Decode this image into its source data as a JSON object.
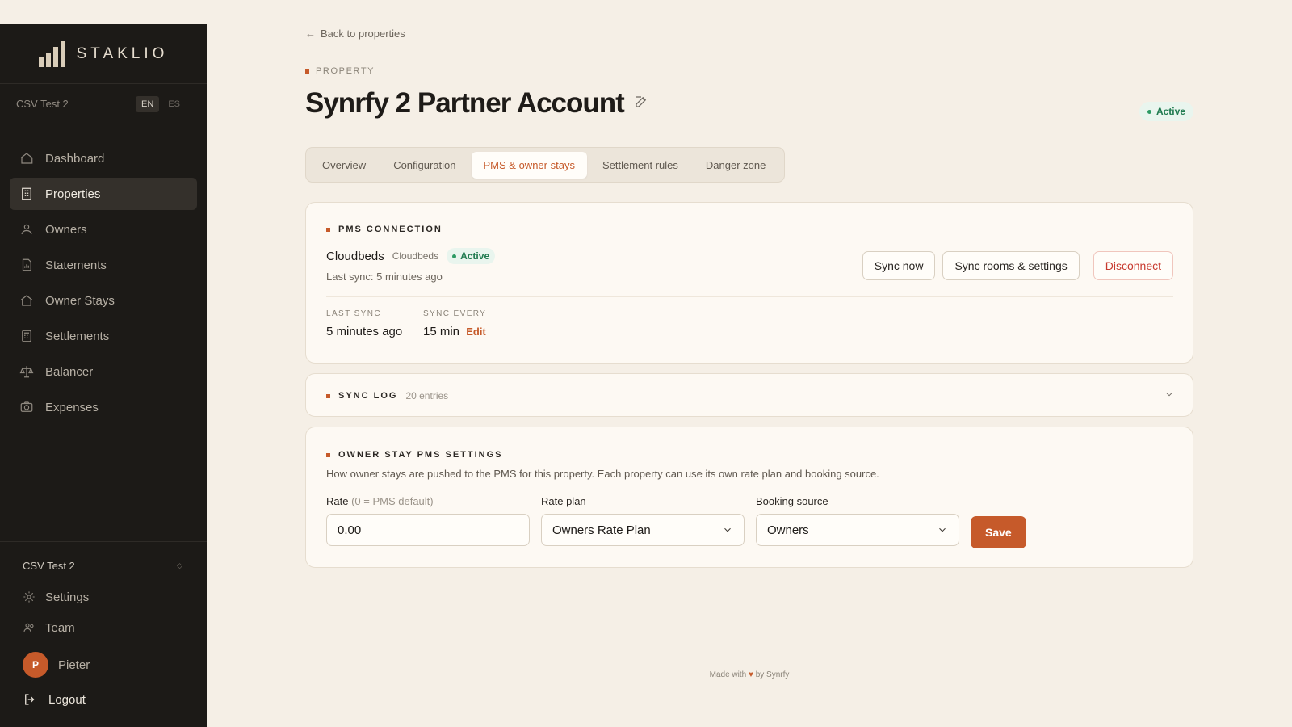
{
  "brand": {
    "name": "STAKLIO"
  },
  "org": {
    "name": "CSV Test 2"
  },
  "lang": {
    "en": "EN",
    "es": "ES"
  },
  "nav": {
    "items": [
      {
        "label": "Dashboard",
        "icon": "home-icon"
      },
      {
        "label": "Properties",
        "icon": "building-icon"
      },
      {
        "label": "Owners",
        "icon": "owners-icon"
      },
      {
        "label": "Statements",
        "icon": "statement-icon"
      },
      {
        "label": "Owner Stays",
        "icon": "house-icon"
      },
      {
        "label": "Settlements",
        "icon": "calculator-icon"
      },
      {
        "label": "Balancer",
        "icon": "scale-icon"
      },
      {
        "label": "Expenses",
        "icon": "camera-icon"
      }
    ],
    "active": "Properties"
  },
  "sidebar_bottom": {
    "org_switch": "CSV Test 2",
    "settings": "Settings",
    "team": "Team",
    "user": {
      "initial": "P",
      "name": "Pieter"
    },
    "logout": "Logout"
  },
  "page": {
    "back": "Back to properties",
    "eyebrow": "PROPERTY",
    "title": "Synrfy 2 Partner Account",
    "status": "Active"
  },
  "tabs": [
    "Overview",
    "Configuration",
    "PMS & owner stays",
    "Settlement rules",
    "Danger zone"
  ],
  "active_tab": "PMS & owner stays",
  "pms": {
    "heading": "PMS CONNECTION",
    "name": "Cloudbeds",
    "provider": "Cloudbeds",
    "status": "Active",
    "last_sync_line": "Last sync: 5 minutes ago",
    "actions": {
      "sync_now": "Sync now",
      "sync_rooms": "Sync rooms & settings",
      "disconnect": "Disconnect"
    },
    "last_sync_label": "LAST SYNC",
    "last_sync_value": "5 minutes ago",
    "sync_every_label": "SYNC EVERY",
    "sync_every_value": "15 min",
    "edit": "Edit"
  },
  "sync_log": {
    "heading": "SYNC LOG",
    "count": "20 entries"
  },
  "owner_settings": {
    "heading": "OWNER STAY PMS SETTINGS",
    "description": "How owner stays are pushed to the PMS for this property. Each property can use its own rate plan and booking source.",
    "rate_label": "Rate",
    "rate_hint": "(0 = PMS default)",
    "rate_value": "0.00",
    "rate_plan_label": "Rate plan",
    "rate_plan_value": "Owners Rate Plan",
    "booking_source_label": "Booking source",
    "booking_source_value": "Owners",
    "save": "Save"
  },
  "footer": {
    "pre": "Made with",
    "heart": "♥",
    "post": "by Synrfy"
  },
  "colors": {
    "accent": "#c65a2a",
    "sidebar": "#1c1a17",
    "background": "#f5efe6",
    "success": "#1f7a4f",
    "danger": "#c83a2f"
  }
}
